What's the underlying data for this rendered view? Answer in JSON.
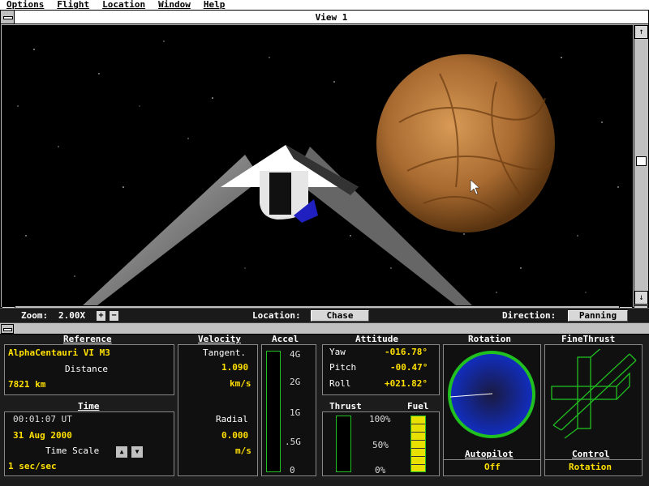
{
  "menu": {
    "items": [
      "Options",
      "Flight",
      "Location",
      "Window",
      "Help"
    ]
  },
  "view": {
    "title": "View 1"
  },
  "toolbar": {
    "zoom_label": "Zoom:",
    "zoom_value": "2.00X",
    "plus": "+",
    "minus": "−",
    "location_label": "Location:",
    "location_value": "Chase",
    "direction_label": "Direction:",
    "direction_value": "Panning"
  },
  "reference": {
    "title": "Reference",
    "name": "AlphaCentauri VI M3",
    "distance_label": "Distance",
    "distance_value": "7821 km"
  },
  "time": {
    "title": "Time",
    "clock": "00:01:07 UT",
    "date": "31 Aug 2000",
    "scale_label": "Time Scale",
    "scale_value": "1 sec/sec"
  },
  "velocity": {
    "title": "Velocity",
    "tangent_label": "Tangent.",
    "tangent_value": "1.090",
    "tangent_unit": "km/s",
    "radial_label": "Radial",
    "radial_value": "0.000",
    "radial_unit": "m/s"
  },
  "accel": {
    "title": "Accel",
    "ticks": [
      "4G",
      "2G",
      "1G",
      ".5G",
      "0"
    ],
    "level": 0
  },
  "attitude": {
    "title": "Attitude",
    "yaw_label": "Yaw",
    "yaw_value": "-016.78°",
    "pitch_label": "Pitch",
    "pitch_value": "-00.47°",
    "roll_label": "Roll",
    "roll_value": "+021.82°"
  },
  "thrust": {
    "title": "Thrust",
    "level": 0
  },
  "fuel": {
    "title": "Fuel",
    "ticks": [
      "100%",
      "50%",
      "0%"
    ],
    "level": 1.0
  },
  "rotation": {
    "title": "Rotation"
  },
  "finethrust": {
    "title": "FineThrust"
  },
  "autopilot": {
    "title": "Autopilot",
    "value": "Off"
  },
  "control": {
    "title": "Control",
    "value": "Rotation"
  },
  "colors": {
    "accent_yellow": "#ffe000",
    "rotation_ring": "#20c020",
    "rotation_fill": "#1030c0",
    "gauge_green": "#20c020",
    "planet": "#b07030"
  }
}
